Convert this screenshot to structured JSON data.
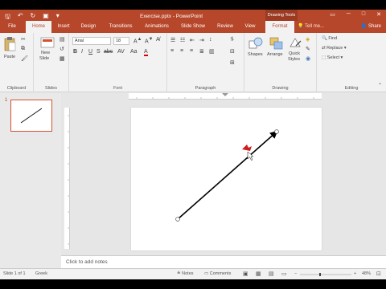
{
  "title_bar": {
    "window_title": "Exercise.pptx - PowerPoint",
    "contextual_tab_group": "Drawing Tools"
  },
  "tabs": [
    "File",
    "Home",
    "Insert",
    "Design",
    "Transitions",
    "Animations",
    "Slide Show",
    "Review",
    "View",
    "Format"
  ],
  "tell_me": "Tell me...",
  "share": "Share",
  "ribbon": {
    "clipboard": {
      "label": "Clipboard",
      "paste": "Paste"
    },
    "slides": {
      "label": "Slides",
      "new_slide_1": "New",
      "new_slide_2": "Slide"
    },
    "font": {
      "label": "Font",
      "font_name": "Arial",
      "font_size": "18"
    },
    "paragraph": {
      "label": "Paragraph"
    },
    "drawing": {
      "label": "Drawing",
      "shapes": "Shapes",
      "arrange": "Arrange",
      "quick_styles_1": "Quick",
      "quick_styles_2": "Styles"
    },
    "editing": {
      "label": "Editing",
      "find": "Find",
      "replace": "Replace",
      "select": "Select"
    }
  },
  "thumbnail_number": "1",
  "notes_placeholder": "Click to add notes",
  "status": {
    "slide_info": "Slide 1 of 1",
    "language": "Greek",
    "notes": "Notes",
    "comments": "Comments",
    "zoom": "48%"
  },
  "colors": {
    "accent": "#b7472a",
    "thumbnail_border": "#d35230",
    "cursor": "#cc1f1f"
  }
}
